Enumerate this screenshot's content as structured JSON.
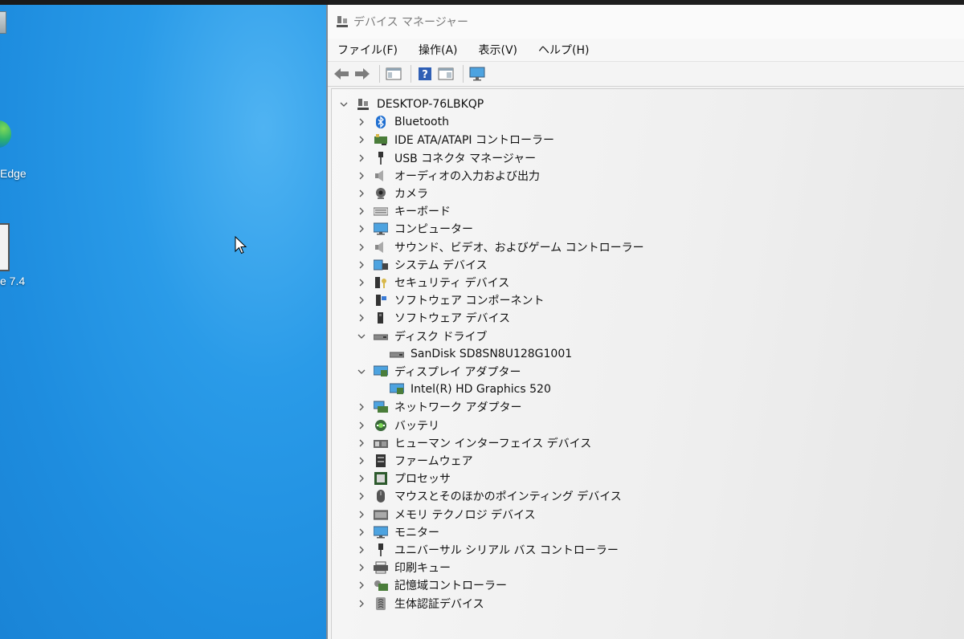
{
  "desktop": {
    "icons": [
      {
        "label": ""
      },
      {
        "label": "Edge"
      },
      {
        "label": "e 7.4"
      }
    ]
  },
  "window": {
    "title": "デバイス マネージャー",
    "menu": [
      "ファイル(F)",
      "操作(A)",
      "表示(V)",
      "ヘルプ(H)"
    ],
    "toolbar": [
      "back-icon",
      "forward-icon",
      "properties-pane-icon",
      "help-icon",
      "action-pane-icon",
      "monitor-scan-icon"
    ],
    "root": "DESKTOP-76LBKQP",
    "categories": [
      {
        "label": "Bluetooth",
        "icon": "bluetooth-icon",
        "expanded": false
      },
      {
        "label": "IDE ATA/ATAPI コントローラー",
        "icon": "ide-controller-icon",
        "expanded": false
      },
      {
        "label": "USB コネクタ マネージャー",
        "icon": "usb-connector-icon",
        "expanded": false
      },
      {
        "label": "オーディオの入力および出力",
        "icon": "speaker-icon",
        "expanded": false
      },
      {
        "label": "カメラ",
        "icon": "camera-icon",
        "expanded": false
      },
      {
        "label": "キーボード",
        "icon": "keyboard-icon",
        "expanded": false
      },
      {
        "label": "コンピューター",
        "icon": "computer-icon",
        "expanded": false
      },
      {
        "label": "サウンド、ビデオ、およびゲーム コントローラー",
        "icon": "sound-icon",
        "expanded": false
      },
      {
        "label": "システム デバイス",
        "icon": "system-device-icon",
        "expanded": false
      },
      {
        "label": "セキュリティ デバイス",
        "icon": "security-device-icon",
        "expanded": false
      },
      {
        "label": "ソフトウェア コンポーネント",
        "icon": "software-component-icon",
        "expanded": false
      },
      {
        "label": "ソフトウェア デバイス",
        "icon": "software-device-icon",
        "expanded": false
      },
      {
        "label": "ディスク ドライブ",
        "icon": "disk-drive-icon",
        "expanded": true,
        "children": [
          {
            "label": "SanDisk SD8SN8U128G1001",
            "icon": "disk-drive-icon"
          }
        ]
      },
      {
        "label": "ディスプレイ アダプター",
        "icon": "display-adapter-icon",
        "expanded": true,
        "children": [
          {
            "label": "Intel(R) HD Graphics 520",
            "icon": "display-adapter-icon"
          }
        ]
      },
      {
        "label": "ネットワーク アダプター",
        "icon": "network-adapter-icon",
        "expanded": false
      },
      {
        "label": "バッテリ",
        "icon": "battery-icon",
        "expanded": false
      },
      {
        "label": "ヒューマン インターフェイス デバイス",
        "icon": "hid-icon",
        "expanded": false
      },
      {
        "label": "ファームウェア",
        "icon": "firmware-icon",
        "expanded": false
      },
      {
        "label": "プロセッサ",
        "icon": "processor-icon",
        "expanded": false
      },
      {
        "label": "マウスとそのほかのポインティング デバイス",
        "icon": "mouse-icon",
        "expanded": false
      },
      {
        "label": "メモリ テクノロジ デバイス",
        "icon": "memory-icon",
        "expanded": false
      },
      {
        "label": "モニター",
        "icon": "monitor-icon",
        "expanded": false
      },
      {
        "label": "ユニバーサル シリアル バス コントローラー",
        "icon": "usb-controller-icon",
        "expanded": false
      },
      {
        "label": "印刷キュー",
        "icon": "printer-icon",
        "expanded": false
      },
      {
        "label": "記憶域コントローラー",
        "icon": "storage-controller-icon",
        "expanded": false
      },
      {
        "label": "生体認証デバイス",
        "icon": "biometric-icon",
        "expanded": false
      }
    ]
  }
}
